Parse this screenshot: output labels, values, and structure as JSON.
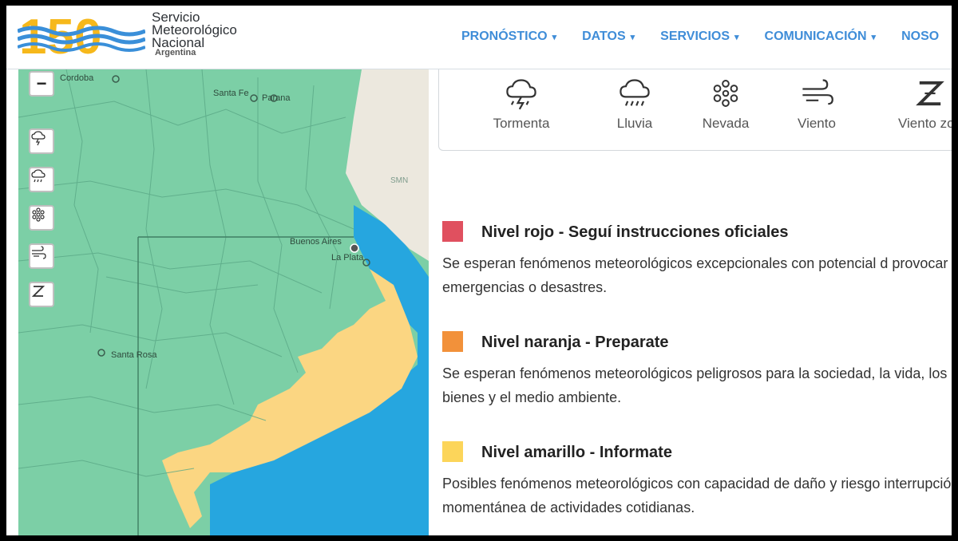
{
  "brand": {
    "line1": "Servicio",
    "line2": "Meteorológico",
    "line3": "Nacional",
    "line4": "Argentina",
    "logo_number": "150"
  },
  "nav": [
    {
      "label": "PRONÓSTICO"
    },
    {
      "label": "DATOS"
    },
    {
      "label": "SERVICIOS"
    },
    {
      "label": "COMUNICACIÓN"
    },
    {
      "label": "NOSO"
    }
  ],
  "map": {
    "zoom_out_label": "−",
    "cities": {
      "cordoba": "Cordoba",
      "santa_fe": "Santa Fe",
      "parana": "Parana",
      "buenos_aires": "Buenos Aires",
      "la_plata": "La Plata",
      "santa_rosa": "Santa Rosa"
    },
    "watermark": "SMN",
    "tools": [
      "storm-icon",
      "rain-icon",
      "snow-icon",
      "wind-icon",
      "zonda-icon"
    ]
  },
  "phenomena": [
    {
      "label": "Tormenta",
      "icon": "storm-icon"
    },
    {
      "label": "Lluvia",
      "icon": "rain-icon"
    },
    {
      "label": "Nevada",
      "icon": "snow-icon"
    },
    {
      "label": "Viento",
      "icon": "wind-icon"
    },
    {
      "label": "Viento zon",
      "icon": "zonda-icon"
    }
  ],
  "levels": [
    {
      "title": "Nivel rojo - Seguí instrucciones oficiales",
      "color": "#e0505f",
      "desc": "Se esperan fenómenos meteorológicos excepcionales con potencial d provocar emergencias o desastres."
    },
    {
      "title": "Nivel naranja - Preparate",
      "color": "#f2913a",
      "desc": "Se esperan fenómenos meteorológicos peligrosos para la sociedad, la vida, los bienes y el medio ambiente."
    },
    {
      "title": "Nivel amarillo - Informate",
      "color": "#fcd55a",
      "desc": "Posibles fenómenos meteorológicos con capacidad de daño y riesgo interrupción momentánea de actividades cotidianas."
    }
  ],
  "colors": {
    "accent": "#3f8dd8",
    "map_green": "#7ccfa6",
    "map_yellow": "#fbd682",
    "sea": "#26a6df",
    "uruguay": "#ece8de"
  }
}
